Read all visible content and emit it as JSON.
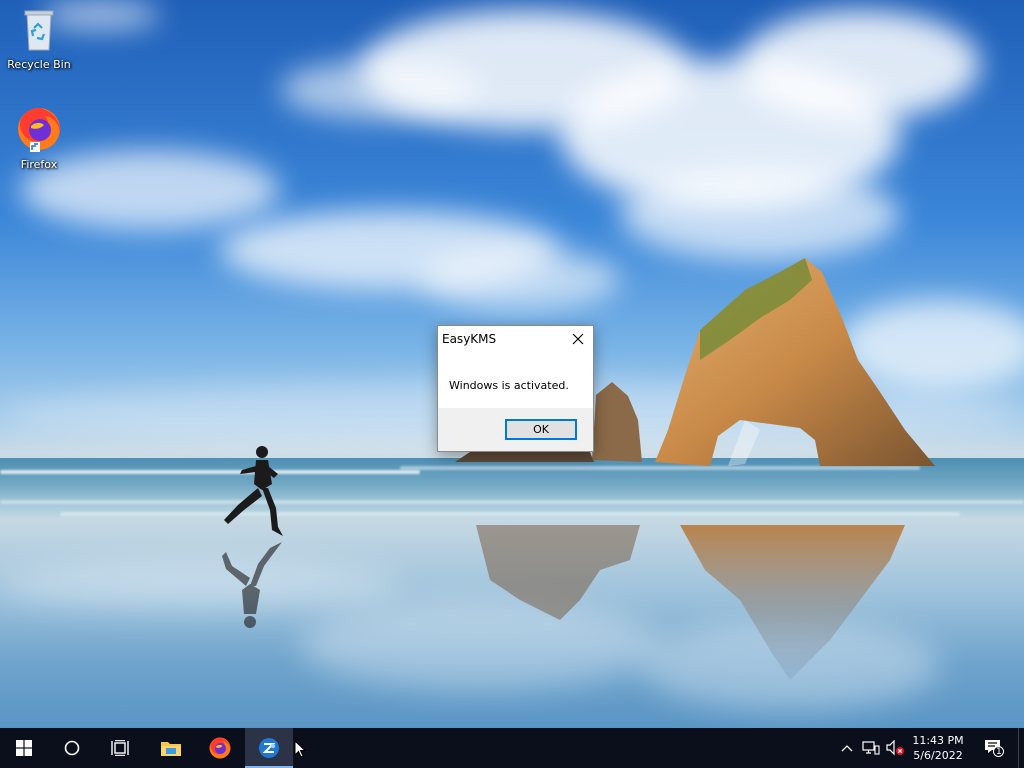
{
  "desktop": {
    "icons": [
      {
        "label": "Recycle Bin",
        "icon": "recycle-bin-icon"
      },
      {
        "label": "Firefox",
        "icon": "firefox-icon"
      }
    ]
  },
  "dialog": {
    "title": "EasyKMS",
    "message": "Windows is activated.",
    "ok_label": "OK"
  },
  "taskbar": {
    "buttons": [
      {
        "icon": "windows-start-icon"
      },
      {
        "icon": "search-circle-icon"
      },
      {
        "icon": "task-view-icon"
      },
      {
        "icon": "file-explorer-icon"
      },
      {
        "icon": "firefox-icon"
      },
      {
        "icon": "easykms-icon",
        "active": true
      }
    ],
    "tray": {
      "icons": [
        "chevron-up-icon",
        "network-icon",
        "volume-muted-icon"
      ],
      "time": "11:43 PM",
      "date": "5/6/2022",
      "notification_count": "1"
    }
  },
  "colors": {
    "taskbar_bg": "#0b0f1c",
    "accent": "#0078d7",
    "dialog_footer": "#f0f0f0"
  }
}
